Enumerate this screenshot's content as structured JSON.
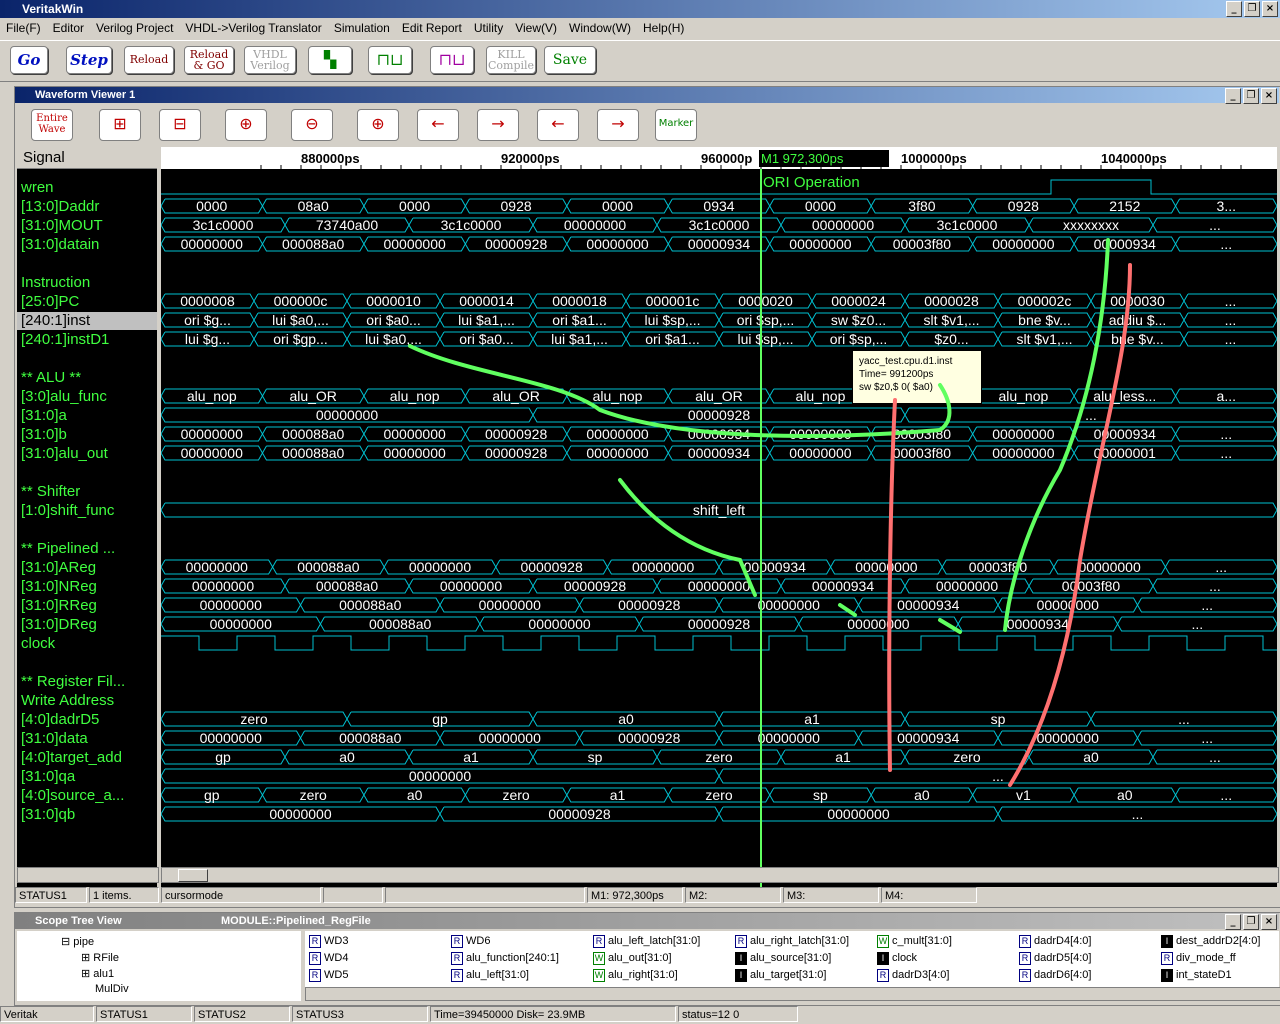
{
  "window": {
    "title": "VeritakWin"
  },
  "menu": [
    "File(F)",
    "Editor",
    "Verilog Project",
    "VHDL->Verilog Translator",
    "Simulation",
    "Edit Report",
    "Utility",
    "View(V)",
    "Window(W)",
    "Help(H)"
  ],
  "toolbar": {
    "go": "Go",
    "step": "Step",
    "reload": "Reload",
    "reload_go_1": "Reload",
    "reload_go_2": "& GO",
    "vhdl_1": "VHDL",
    "vhdl_2": "Verilog",
    "kill_1": "KILL",
    "kill_2": "Compile",
    "save": "Save"
  },
  "waveform": {
    "title": "Waveform Viewer 1",
    "entire_1": "Entire",
    "entire_2": "Wave",
    "marker": "Marker",
    "signal_header": "Signal",
    "time_labels": [
      "880000ps",
      "920000ps",
      "960000p",
      "1000000ps",
      "1040000ps"
    ],
    "cursor_label": "M1    972,300ps",
    "annotation": "ORI Operation",
    "signals": [
      "wren",
      "[13:0]Daddr",
      "[31:0]MOUT",
      "[31:0]datain",
      "",
      "Instruction",
      "[25:0]PC",
      "[240:1]inst",
      "[240:1]instD1",
      "",
      "** ALU **",
      "[3:0]alu_func",
      "[31:0]a",
      "[31:0]b",
      "[31:0]alu_out",
      "",
      "** Shifter",
      "[1:0]shift_func",
      "",
      "** Pipelined ...",
      "[31:0]AReg",
      "[31:0]NReg",
      "[31:0]RReg",
      "[31:0]DReg",
      "clock",
      "",
      "** Register Fil...",
      " Write Address",
      "[4:0]dadrD5",
      "[31:0]data",
      "[4:0]target_add",
      "[31:0]qa",
      "[4:0]source_a...",
      "[31:0]qb"
    ],
    "rows": [
      {
        "row": 1,
        "v": [
          "0000",
          "08a0",
          "0000",
          "0928",
          "0000",
          "0934",
          "0000",
          "3f80",
          "0928",
          "2152",
          "3..."
        ]
      },
      {
        "row": 2,
        "v": [
          "3c1c0000",
          "73740a00",
          "3c1c0000",
          "00000000",
          "3c1c0000",
          "00000000",
          "3c1c0000",
          "xxxxxxxx",
          "..."
        ]
      },
      {
        "row": 3,
        "v": [
          "00000000",
          "000088a0",
          "00000000",
          "00000928",
          "00000000",
          "00000934",
          "00000000",
          "00003f80",
          "00000000",
          "00000934",
          "..."
        ]
      },
      {
        "row": 6,
        "v": [
          "0000008",
          "000000c",
          "0000010",
          "0000014",
          "0000018",
          "000001c",
          "0000020",
          "0000024",
          "0000028",
          "000002c",
          "0000030",
          "..."
        ]
      },
      {
        "row": 7,
        "v": [
          "ori  $g...",
          "lui  $a0,...",
          "ori  $a0...",
          "lui  $a1,...",
          "ori  $a1...",
          "lui  $sp,...",
          "ori  $sp,...",
          "sw  $z0...",
          "slt  $v1,...",
          "bne  $v...",
          "addiu  $...",
          "..."
        ]
      },
      {
        "row": 8,
        "v": [
          "lui  $g...",
          "ori  $gp...",
          "lui  $a0,...",
          "ori  $a0...",
          "lui  $a1,...",
          "ori  $a1...",
          "lui  $sp,...",
          "ori  $sp,...",
          "$z0...",
          "slt  $v1,...",
          "bne  $v...",
          "..."
        ]
      },
      {
        "row": 11,
        "v": [
          "alu_nop",
          "alu_OR",
          "alu_nop",
          "alu_OR",
          "alu_nop",
          "alu_OR",
          "alu_nop",
          "alu_OR",
          "alu_nop",
          "alu_less...",
          "a..."
        ]
      },
      {
        "row": 12,
        "v": [
          "00000000",
          "00000928",
          "..."
        ]
      },
      {
        "row": 13,
        "v": [
          "00000000",
          "000088a0",
          "00000000",
          "00000928",
          "00000000",
          "00000934",
          "00000000",
          "00003f80",
          "00000000",
          "00000934",
          "..."
        ]
      },
      {
        "row": 14,
        "v": [
          "00000000",
          "000088a0",
          "00000000",
          "00000928",
          "00000000",
          "00000934",
          "00000000",
          "00003f80",
          "00000000",
          "00000001",
          "..."
        ]
      },
      {
        "row": 17,
        "v": [
          "shift_left"
        ]
      },
      {
        "row": 20,
        "v": [
          "00000000",
          "000088a0",
          "00000000",
          "00000928",
          "00000000",
          "00000934",
          "00000000",
          "00003f80",
          "00000000",
          "..."
        ]
      },
      {
        "row": 21,
        "v": [
          "00000000",
          "000088a0",
          "00000000",
          "00000928",
          "00000000",
          "00000934",
          "00000000",
          "00003f80",
          "..."
        ]
      },
      {
        "row": 22,
        "v": [
          "00000000",
          "000088a0",
          "00000000",
          "00000928",
          "00000000",
          "00000934",
          "00000000",
          "..."
        ]
      },
      {
        "row": 23,
        "v": [
          "00000000",
          "000088a0",
          "00000000",
          "00000928",
          "00000000",
          "00000934",
          "..."
        ]
      },
      {
        "row": 28,
        "v": [
          "zero",
          "gp",
          "a0",
          "a1",
          "sp",
          "..."
        ]
      },
      {
        "row": 29,
        "v": [
          "00000000",
          "000088a0",
          "00000000",
          "00000928",
          "00000000",
          "00000934",
          "00000000",
          "..."
        ]
      },
      {
        "row": 30,
        "v": [
          "gp",
          "a0",
          "a1",
          "sp",
          "zero",
          "a1",
          "zero",
          "a0",
          "..."
        ]
      },
      {
        "row": 31,
        "v": [
          "00000000",
          "..."
        ]
      },
      {
        "row": 32,
        "v": [
          "gp",
          "zero",
          "a0",
          "zero",
          "a1",
          "zero",
          "sp",
          "a0",
          "v1",
          "a0",
          "..."
        ]
      },
      {
        "row": 33,
        "v": [
          "00000000",
          "00000928",
          "00000000",
          "..."
        ]
      }
    ],
    "tooltip": [
      "yacc_test.cpu.d1.inst",
      "Time= 991200ps",
      "sw  $z0,$   0( $a0)"
    ],
    "status": [
      "STATUS1",
      "1 items.",
      "cursormode",
      "",
      "",
      "M1: 972,300ps",
      "M2:",
      "M3:",
      "M4:"
    ]
  },
  "scope": {
    "title": "Scope Tree View",
    "module": "MODULE::Pipelined_RegFile",
    "tree": [
      "pipe",
      "RFile",
      "alu1",
      "MulDiv"
    ],
    "ports": [
      [
        "R",
        "WD3"
      ],
      [
        "R",
        "WD6"
      ],
      [
        "R",
        "alu_left_latch[31:0]"
      ],
      [
        "R",
        "alu_right_latch[31:0]"
      ],
      [
        "W",
        "c_mult[31:0]"
      ],
      [
        "R",
        "dadrD4[4:0]"
      ],
      [
        "I",
        "dest_addrD2[4:0]"
      ],
      [
        "R",
        "WD4"
      ],
      [
        "R",
        "alu_function[240:1]"
      ],
      [
        "W",
        "alu_out[31:0]"
      ],
      [
        "I",
        "alu_source[31:0]"
      ],
      [
        "I",
        "clock"
      ],
      [
        "R",
        "dadrD5[4:0]"
      ],
      [
        "R",
        "div_mode_ff"
      ],
      [
        "R",
        "WD5"
      ],
      [
        "R",
        "alu_left[31:0]"
      ],
      [
        "W",
        "alu_right[31:0]"
      ],
      [
        "I",
        "alu_target[31:0]"
      ],
      [
        "R",
        "dadrD3[4:0]"
      ],
      [
        "R",
        "dadrD6[4:0]"
      ],
      [
        "I",
        "int_stateD1"
      ]
    ]
  },
  "bottom_status": [
    "Veritak",
    "STATUS1",
    "STATUS2",
    "STATUS3",
    "Time=39450000 Disk= 23.9MB",
    "status=12 0"
  ]
}
